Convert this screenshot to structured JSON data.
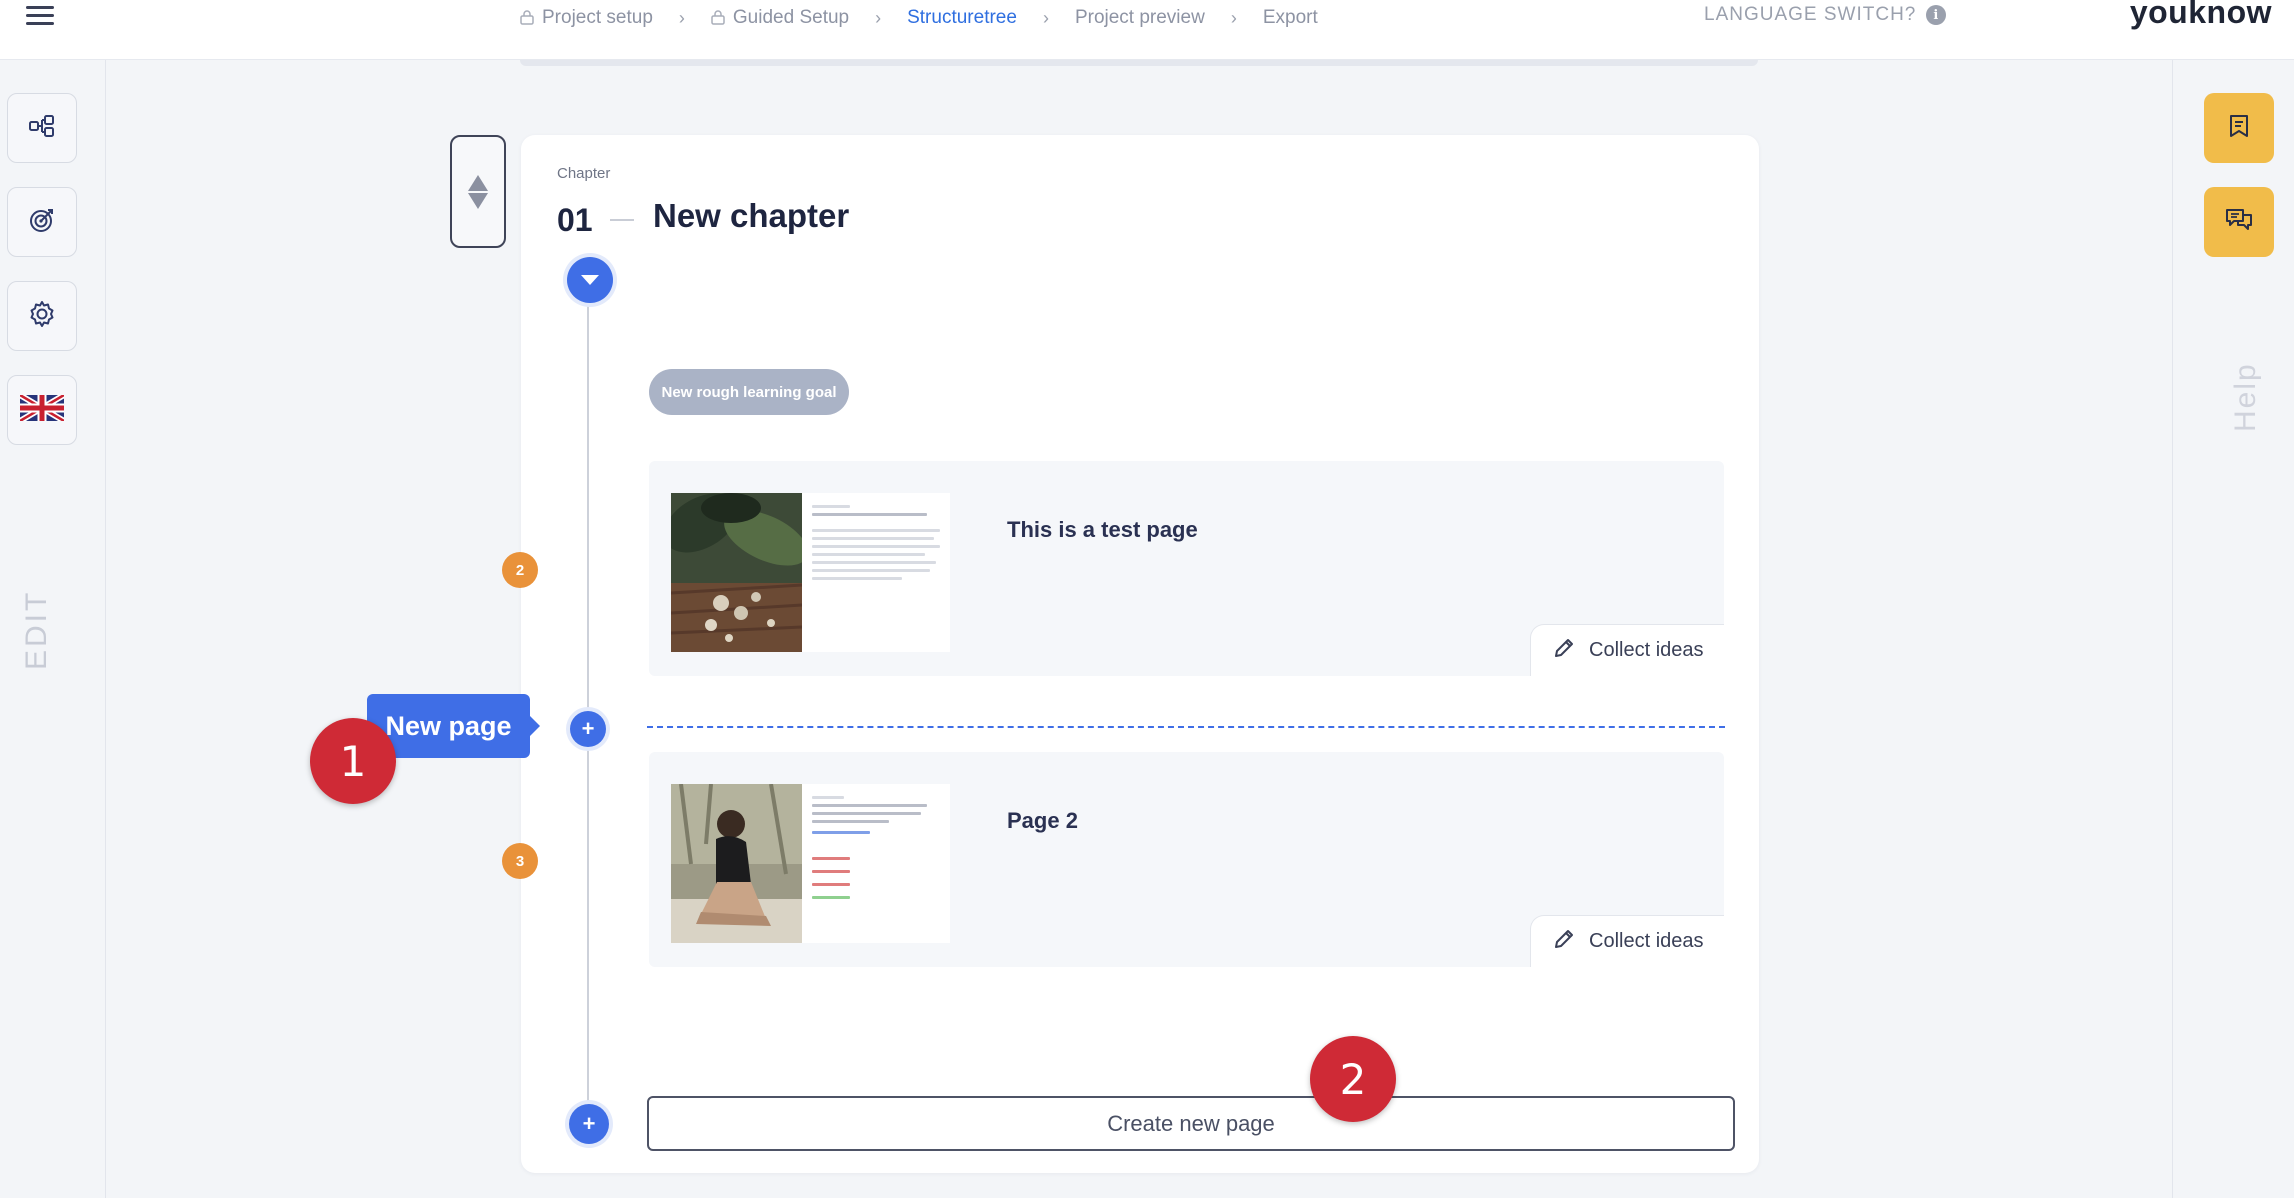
{
  "topbar": {
    "breadcrumbs": [
      {
        "label": "Project setup",
        "locked": true
      },
      {
        "label": "Guided Setup",
        "locked": true
      },
      {
        "label": "Structuretree",
        "active": true
      },
      {
        "label": "Project preview"
      },
      {
        "label": "Export"
      }
    ],
    "language_label": "LANGUAGE SWITCH?",
    "info_glyph": "i",
    "brand": "youknow"
  },
  "left_sidebar": {
    "icons": [
      "structure-icon",
      "target-icon",
      "gear-icon",
      "uk-flag-icon"
    ],
    "mode_label": "EDIT"
  },
  "right_sidebar": {
    "icons": [
      "bookmark-icon",
      "chat-icon"
    ],
    "help_label": "Help",
    "accent_color": "#f1bc4a"
  },
  "chapter": {
    "label": "Chapter",
    "number": "01",
    "title": "New chapter",
    "goal_pill": "New rough learning goal",
    "pages": [
      {
        "badge": "2",
        "title": "This is a test page",
        "action": "Collect ideas"
      },
      {
        "badge": "3",
        "title": "Page 2",
        "action": "Collect ideas"
      }
    ],
    "insert_tooltip": "New page",
    "insert_plus": "+",
    "bottom_plus": "+",
    "create_button": "Create new page"
  },
  "annotations": {
    "marker_1": "1",
    "marker_2": "2",
    "marker_color": "#cf2a36"
  },
  "colors": {
    "accent_blue": "#3f6ee6",
    "badge_orange": "#e9923a"
  }
}
